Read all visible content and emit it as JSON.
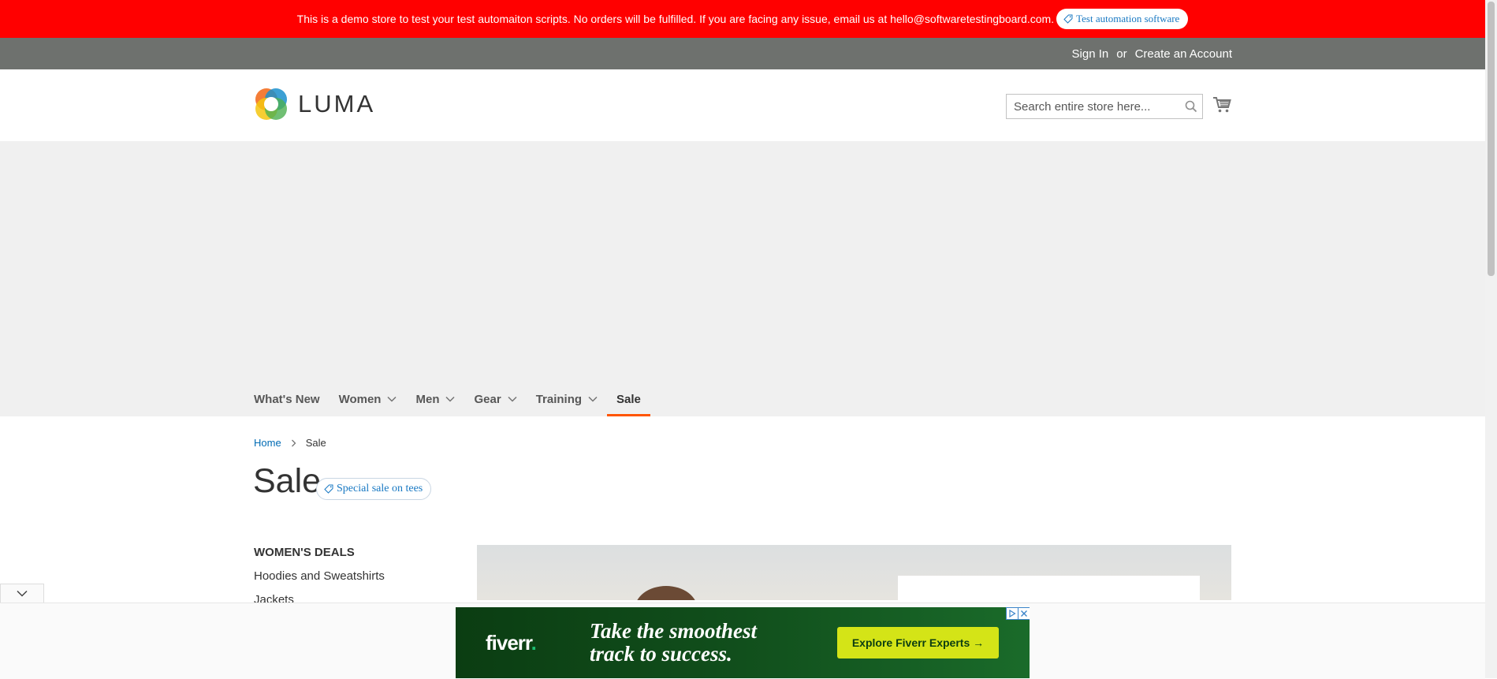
{
  "banner": {
    "message": "This is a demo store to test your test automaiton scripts. No orders will be fulfilled. If you are facing any issue, email us at hello@softwaretestingboard.com.",
    "badge": "Test automation software"
  },
  "top_links": {
    "sign_in": "Sign In",
    "separator": "or",
    "create_account": "Create an Account"
  },
  "header": {
    "logo_text": "LUMA",
    "search_placeholder": "Search entire store here..."
  },
  "nav": {
    "items": [
      {
        "label": "What's New",
        "has_dropdown": false
      },
      {
        "label": "Women",
        "has_dropdown": true
      },
      {
        "label": "Men",
        "has_dropdown": true
      },
      {
        "label": "Gear",
        "has_dropdown": true
      },
      {
        "label": "Training",
        "has_dropdown": true
      },
      {
        "label": "Sale",
        "has_dropdown": false,
        "active": true
      }
    ]
  },
  "breadcrumb": {
    "home": "Home",
    "current": "Sale"
  },
  "page": {
    "title": "Sale",
    "title_badge": "Special sale on tees"
  },
  "sidebar": {
    "heading": "WOMEN'S DEALS",
    "links": [
      "Hoodies and Sweatshirts",
      "Jackets"
    ]
  },
  "ad": {
    "brand": "fiverr",
    "brand_dot": ".",
    "headline": "Take the smoothest track to success.",
    "cta": "Explore Fiverr Experts →"
  },
  "colors": {
    "banner": "#ff0000",
    "top_bar": "#6e716e",
    "link": "#006bb4",
    "active_nav": "#ff5501",
    "ad_cta": "#d4e417"
  }
}
